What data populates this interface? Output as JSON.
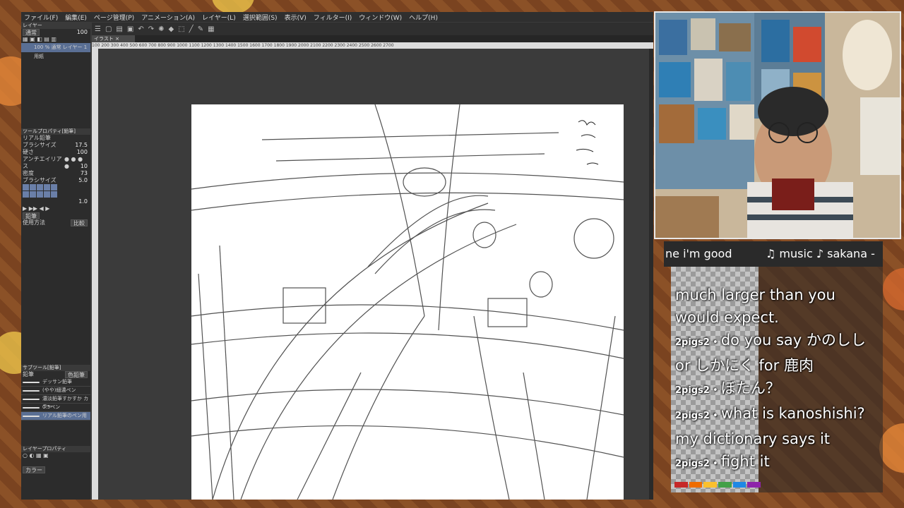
{
  "colors": {
    "app_bg": "#3b3b3b",
    "panel_bg": "#2c2c2c",
    "selection": "#5a6f94",
    "frame_brown": "#7a4320",
    "chat_user_dot": "#4caf50"
  },
  "menu": [
    "ファイル(F)",
    "編集(E)",
    "ページ管理(P)",
    "アニメーション(A)",
    "レイヤー(L)",
    "選択範囲(S)",
    "表示(V)",
    "フィルター(I)",
    "ウィンドウ(W)",
    "ヘルプ(H)"
  ],
  "toolbar_icons": [
    "menu-icon",
    "new-icon",
    "open-icon",
    "save-icon",
    "undo-icon",
    "redo-icon",
    "brightness-icon",
    "fill-icon",
    "transform-icon",
    "pen-icon",
    "pencil-icon",
    "ruler-icon"
  ],
  "document_tab": "イラスト",
  "ruler_text": "100 200 300 400 500 600 700 800 900 1000 1100 1200 1300 1400 1500 1600 1700 1800 1900 2000 2100 2200 2300 2400 2500 2600 2700",
  "layers": {
    "title": "レイヤー",
    "blend_mode": "通常",
    "opacity": "100",
    "items": [
      {
        "name": "100 % 通常",
        "sub": "レイヤー 1",
        "selected": true
      },
      {
        "name": "用紙",
        "sub": "",
        "selected": false
      }
    ]
  },
  "tool_property": {
    "title": "ツールプロパティ[鉛筆]",
    "brush_name": "リアル鉛筆",
    "rows": [
      {
        "label": "ブラシサイズ",
        "value": "17.5"
      },
      {
        "label": "硬さ",
        "value": "100"
      },
      {
        "label": "アンチエイリアス",
        "value": ""
      },
      {
        "label": "",
        "value": "10"
      },
      {
        "label": "密度",
        "value": "73"
      },
      {
        "label": "ブラシサイズ",
        "value": "5.0"
      },
      {
        "label": "",
        "value": "1.0"
      }
    ],
    "button": "鉛筆",
    "method_label": "使用方法",
    "method_value": "比較"
  },
  "sub_tool": {
    "title": "サブツール[鉛筆]",
    "tabs": [
      "鉛筆",
      "色鉛筆"
    ],
    "brushes": [
      "デッサン鉛筆",
      "(やや)細濃ペン",
      "濃淡鉛筆すかすか カラー",
      "0.5ペン",
      "リアル鉛筆のペン用"
    ]
  },
  "color_panel": {
    "title": "レイヤープロパティ",
    "dropdown": "カラー"
  },
  "ticker": {
    "left": "ne i'm good",
    "right": "♫ music ♪ sakana -"
  },
  "chat": [
    {
      "user": "",
      "text": "much larger than you"
    },
    {
      "user": "",
      "text": "would expect."
    },
    {
      "user": "2pigs2",
      "text": "do you say かのしし or しかにく for 鹿肉"
    },
    {
      "user": "2pigs2",
      "text": "ぼたん？"
    },
    {
      "user": "2pigs2",
      "text": "what is kanoshishi? my dictionary says it"
    },
    {
      "user": "2pigs2",
      "text": "fight it"
    }
  ]
}
